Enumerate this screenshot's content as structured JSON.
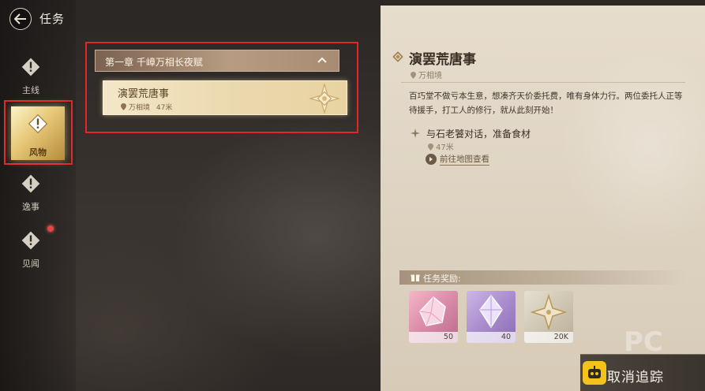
{
  "header": {
    "title": "任务"
  },
  "categories": [
    {
      "label": "主线",
      "icon": "alert-diamond-icon"
    },
    {
      "label": "风物",
      "icon": "alert-diamond-icon",
      "selected": true
    },
    {
      "label": "逸事",
      "icon": "alert-diamond-icon"
    },
    {
      "label": "见闻",
      "icon": "alert-diamond-icon",
      "badge": true
    }
  ],
  "quest_list": {
    "chapter": "第一章 千嶂万相长夜赋",
    "quests": [
      {
        "name": "演罢荒唐事",
        "location": "万相境",
        "distance": "47米",
        "selected": true
      }
    ]
  },
  "detail": {
    "title": "演罢荒唐事",
    "location": "万相境",
    "description": "百巧堂不做亏本生意，想凑齐天价委托费，唯有身体力行。两位委托人正等待援手，打工人的修行，就从此刻开始！",
    "objective": {
      "text": "与石老饕对话，准备食材",
      "distance": "47米"
    },
    "map_link": "前往地图查看",
    "rewards_label": "任务奖励:",
    "rewards": [
      {
        "icon": "pink-crystal-icon",
        "count": "50"
      },
      {
        "icon": "purple-crystal-icon",
        "count": "40"
      },
      {
        "icon": "gold-star-coin-icon",
        "count": "20K"
      }
    ],
    "cancel_button": "取消追踪"
  },
  "watermark": "PC",
  "colors": {
    "highlight_border": "#e0282c",
    "selected_tile": "#e6c777",
    "panel_bg": "#e7ddcd",
    "accent_yellow": "#f3c21b"
  }
}
